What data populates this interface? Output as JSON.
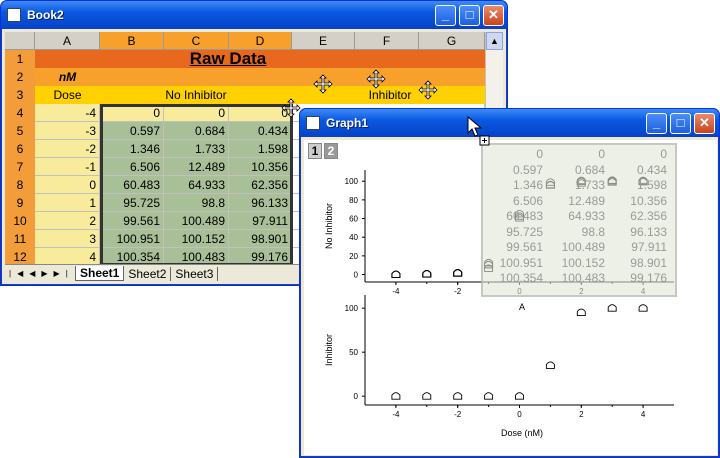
{
  "book": {
    "title": "Book2",
    "col_headers": [
      "A",
      "B",
      "C",
      "D",
      "E",
      "F",
      "G"
    ],
    "row_headers": [
      "1",
      "2",
      "3",
      "4",
      "5",
      "6",
      "7",
      "8",
      "9",
      "10",
      "11",
      "12"
    ],
    "title_cell": "Raw Data",
    "unit": "nM",
    "dose_label": "Dose",
    "no_inhibitor_label": "No Inhibitor",
    "inhibitor_label": "Inhibitor",
    "dose": [
      "-4",
      "-3",
      "-2",
      "-1",
      "0",
      "1",
      "2",
      "3",
      "4"
    ],
    "colB": [
      "0",
      "0.597",
      "1.346",
      "6.506",
      "60.483",
      "95.725",
      "99.561",
      "100.951",
      "100.354"
    ],
    "colC": [
      "0",
      "0.684",
      "1.733",
      "12.489",
      "64.933",
      "98.8",
      "100.489",
      "100.152",
      "100.483"
    ],
    "colD": [
      "0",
      "0.434",
      "1.598",
      "10.356",
      "62.356",
      "96.133",
      "97.911",
      "98.901",
      "99.176"
    ],
    "sheets": [
      "Sheet1",
      "Sheet2",
      "Sheet3"
    ],
    "colors": {
      "title_row": "#e8681e",
      "orange": "#f7a12c",
      "yellow": "#ffd100",
      "dose_col": "#f8ec9c",
      "data": "#a9bf98"
    }
  },
  "graph": {
    "title": "Graph1",
    "layers": [
      "1",
      "2"
    ],
    "panel_label": "A",
    "ylabel_top": "No Inhibitor",
    "ylabel_bottom": "Inhibitor",
    "xlabel": "Dose (nM)",
    "x_ticks": [
      "-4",
      "-2",
      "0",
      "2",
      "4"
    ],
    "y_ticks_top": [
      "0",
      "20",
      "40",
      "60",
      "80",
      "100"
    ],
    "y_ticks_bottom": [
      "0",
      "50",
      "100"
    ]
  },
  "chart_data": [
    {
      "type": "scatter",
      "ylabel": "No Inhibitor",
      "x": [
        -4,
        -3,
        -2,
        -1,
        0,
        1,
        2,
        3,
        4
      ],
      "series": [
        {
          "values": [
            0,
            0.597,
            1.346,
            6.506,
            60.483,
            95.725,
            99.561,
            100.951,
            100.354
          ]
        },
        {
          "values": [
            0,
            0.684,
            1.733,
            12.489,
            64.933,
            98.8,
            100.489,
            100.152,
            100.483
          ]
        },
        {
          "values": [
            0,
            0.434,
            1.598,
            10.356,
            62.356,
            96.133,
            97.911,
            98.901,
            99.176
          ]
        }
      ],
      "xlim": [
        -5,
        5
      ],
      "ylim": [
        -8,
        112
      ]
    },
    {
      "type": "scatter",
      "ylabel": "Inhibitor",
      "xlabel": "Dose (nM)",
      "x": [
        -4,
        -3,
        -2,
        -1,
        0,
        1,
        2,
        3,
        4
      ],
      "series": [
        {
          "values": [
            0,
            0,
            0,
            0,
            0,
            35,
            95,
            100,
            100
          ]
        }
      ],
      "xlim": [
        -5,
        5
      ],
      "ylim": [
        -10,
        115
      ]
    }
  ]
}
